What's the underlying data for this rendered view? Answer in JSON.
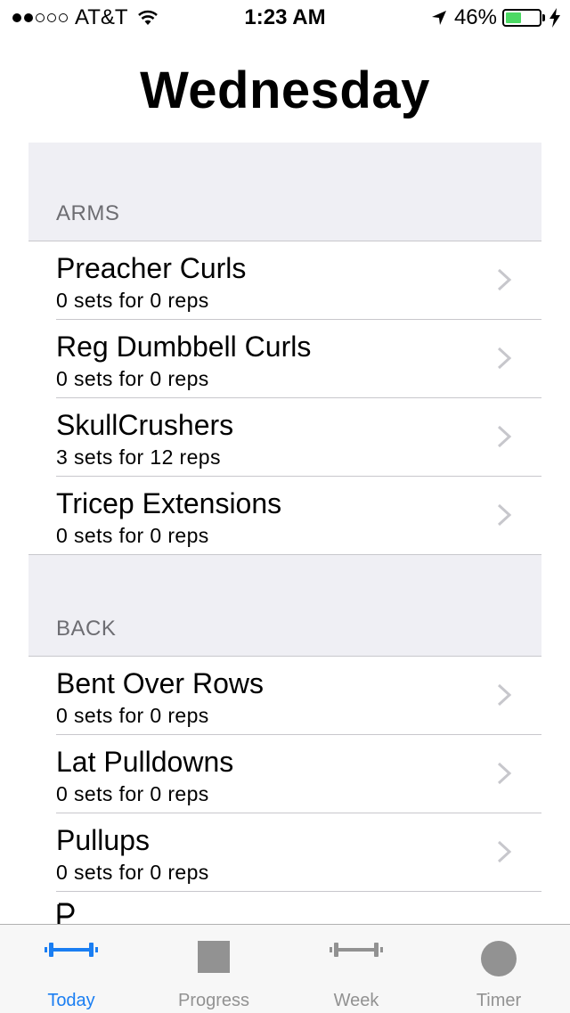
{
  "status_bar": {
    "carrier": "AT&T",
    "time": "1:23 AM",
    "battery": "46%",
    "battery_level": 0.46,
    "signal_bars_filled": 2,
    "signal_bars_total": 5
  },
  "title": "Wednesday",
  "colors": {
    "accent": "#1a7ef2",
    "inactive": "#929292",
    "section_bg": "#efeff4",
    "battery": "#4cd964"
  },
  "sections": [
    {
      "header": "ARMS",
      "rows": [
        {
          "title": "Preacher Curls",
          "subtitle": "0 sets for 0 reps"
        },
        {
          "title": "Reg Dumbbell Curls",
          "subtitle": "0 sets for 0 reps"
        },
        {
          "title": "SkullCrushers",
          "subtitle": "3 sets for 12 reps"
        },
        {
          "title": "Tricep Extensions",
          "subtitle": "0 sets for 0 reps"
        }
      ]
    },
    {
      "header": "BACK",
      "rows": [
        {
          "title": "Bent Over Rows",
          "subtitle": "0 sets for 0 reps"
        },
        {
          "title": "Lat Pulldowns",
          "subtitle": "0 sets for 0 reps"
        },
        {
          "title": "Pullups",
          "subtitle": "0 sets for 0 reps"
        }
      ]
    }
  ],
  "tabs": [
    {
      "label": "Today",
      "icon": "dumbbell-icon",
      "active": true
    },
    {
      "label": "Progress",
      "icon": "square-icon",
      "active": false
    },
    {
      "label": "Week",
      "icon": "dumbbell-icon",
      "active": false
    },
    {
      "label": "Timer",
      "icon": "circle-icon",
      "active": false
    }
  ]
}
